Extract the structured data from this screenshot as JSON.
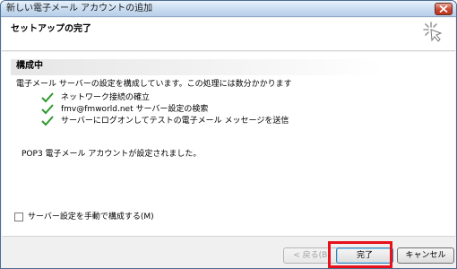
{
  "window": {
    "title": "新しい電子メール アカウントの追加",
    "close_icon": "close-icon"
  },
  "header": {
    "title": "セットアップの完了",
    "icon": "wizard-spark-icon"
  },
  "content": {
    "section_label": "構成中",
    "description": "電子メール サーバーの設定を構成しています。この処理には数分かかります",
    "steps": [
      {
        "icon": "checkmark-icon",
        "label": "ネットワーク接続の確立"
      },
      {
        "icon": "checkmark-icon",
        "label": "fmv@fmworld.net サーバー設定の検索"
      },
      {
        "icon": "checkmark-icon",
        "label": "サーバーにログオンしてテストの電子メール メッセージを送信"
      }
    ],
    "status": "POP3 電子メール アカウントが設定されました。",
    "manual_config": {
      "label": "サーバー設定を手動で構成する(M)",
      "checked": false
    }
  },
  "footer": {
    "back_label": "< 戻る(B)",
    "finish_label": "完了",
    "cancel_label": "キャンセル"
  },
  "colors": {
    "highlight": "#e8101a",
    "check": "#2e9a2e",
    "titlebar": "#c9dcf0"
  }
}
